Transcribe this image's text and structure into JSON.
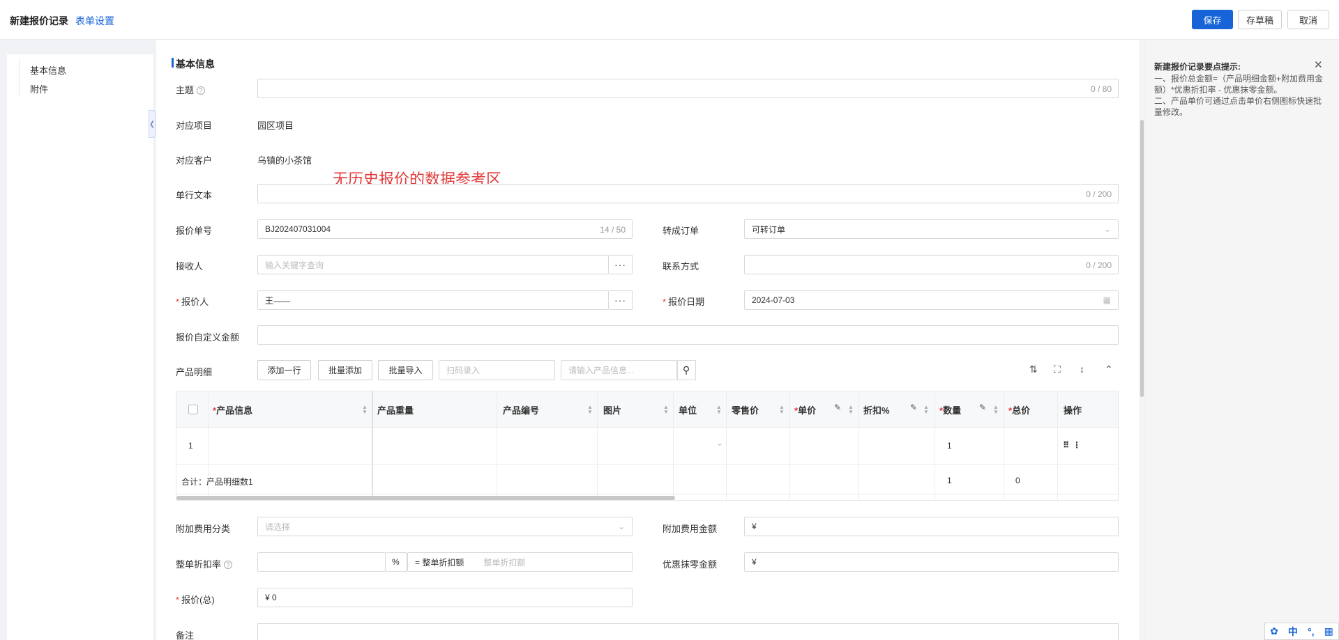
{
  "header": {
    "title": "新建报价记录",
    "form_settings": "表单设置",
    "save": "保存",
    "draft": "存草稿",
    "cancel": "取消"
  },
  "nav": {
    "items": [
      "基本信息",
      "附件"
    ]
  },
  "section": {
    "title": "基本信息"
  },
  "fields": {
    "subject": {
      "label": "主题",
      "value": "",
      "counter": "0 / 80"
    },
    "project": {
      "label": "对应项目",
      "value": "园区项目"
    },
    "customer": {
      "label": "对应客户",
      "value": "乌镇的小茶馆"
    },
    "single_text": {
      "label": "单行文本",
      "value": "",
      "counter": "0 / 200"
    },
    "quote_no": {
      "label": "报价单号",
      "value": "BJ202407031004",
      "counter": "14 / 50"
    },
    "convert_order": {
      "label": "转成订单",
      "value": "可转订单"
    },
    "receiver": {
      "label": "接收人",
      "placeholder": "输入关键字查询"
    },
    "contact": {
      "label": "联系方式",
      "value": "",
      "counter": "0 / 200"
    },
    "quoter": {
      "label": "报价人",
      "value": "王——"
    },
    "quote_date": {
      "label": "报价日期",
      "value": "2024-07-03"
    },
    "custom_amount": {
      "label": "报价自定义金额",
      "value": ""
    },
    "extra_fee_category": {
      "label": "附加费用分类",
      "placeholder": "请选择"
    },
    "extra_fee_amount": {
      "label": "附加费用金额",
      "value": "¥"
    },
    "discount_rate": {
      "label": "整单折扣率",
      "percent": "%",
      "equals": "= 整单折扣额",
      "placeholder": "整单折扣额"
    },
    "rounding": {
      "label": "优惠抹零金额",
      "value": "¥"
    },
    "total": {
      "label": "报价(总)",
      "value": "¥  0"
    },
    "remark": {
      "label": "备注"
    }
  },
  "overlay_note": "无历史报价的数据参考区",
  "products": {
    "label": "产品明细",
    "add_row": "添加一行",
    "batch_add": "批量添加",
    "batch_import": "批量导入",
    "scan_placeholder": "扫码录入",
    "search_placeholder": "请输入产品信息...",
    "columns": {
      "info": "产品信息",
      "weight": "产品重量",
      "code": "产品编号",
      "image": "图片",
      "unit": "单位",
      "retail": "零售价",
      "price": "单价",
      "discount": "折扣%",
      "qty": "数量",
      "total": "总价",
      "ops": "操作"
    },
    "row1": {
      "index": "1",
      "qty": "1"
    },
    "summary": {
      "label": "合计：产品明细数1",
      "qty": "1",
      "total": "0"
    }
  },
  "tips": {
    "title": "新建报价记录要点提示:",
    "body": "一、报价总金额=（产品明细金额+附加费用金额）*优惠折扣率 - 优惠抹零金额。\n二、产品单价可通过点击单价右侧图标快速批量修改。"
  },
  "ime": {
    "mode": "中",
    "punct": "°,"
  }
}
